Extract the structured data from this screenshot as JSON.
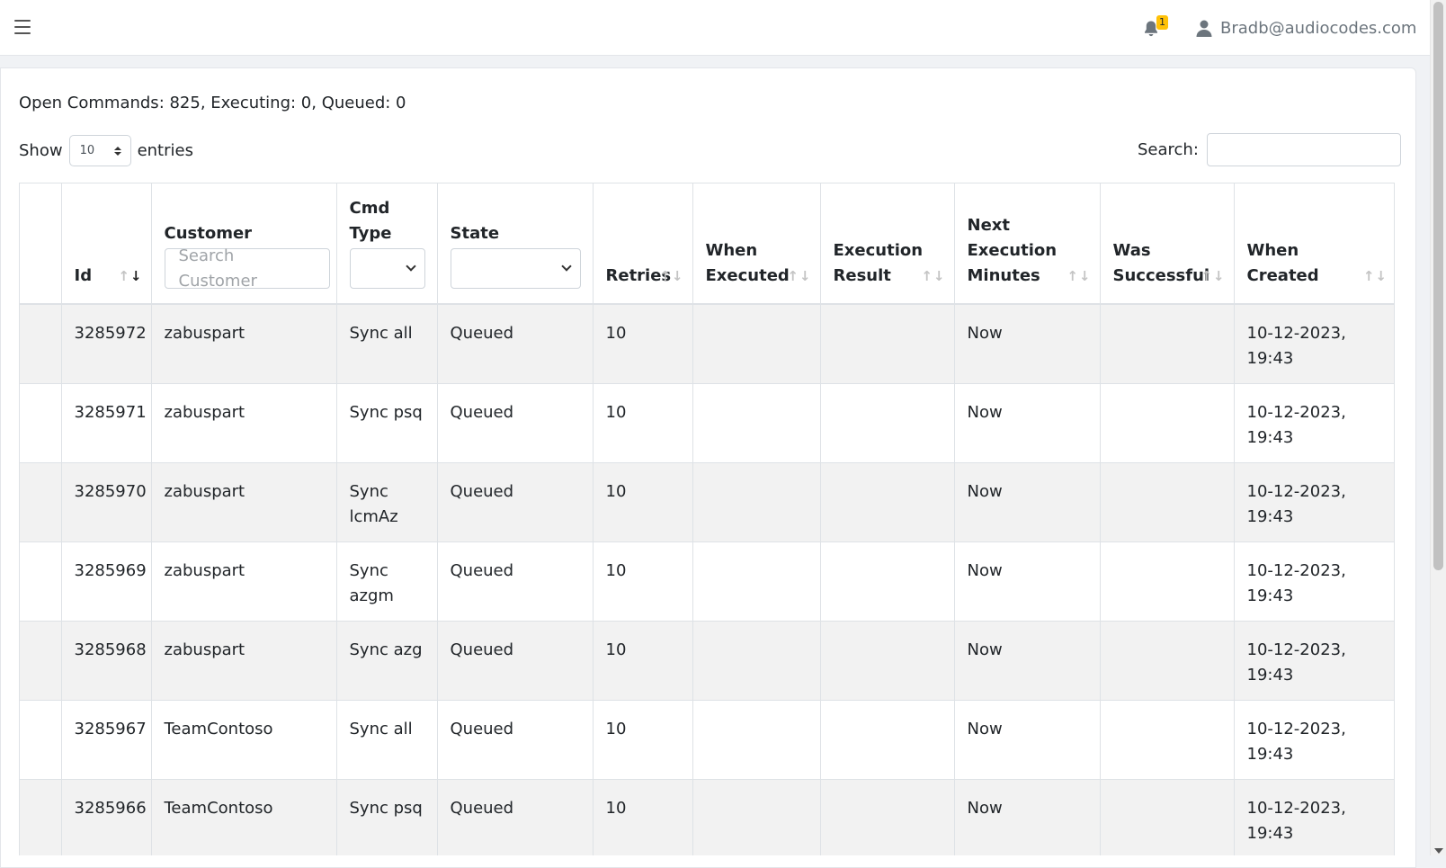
{
  "header": {
    "notification_count": "1",
    "user_email": "Bradb@audiocodes.com"
  },
  "summary": "Open Commands: 825, Executing: 0, Queued: 0",
  "length_control": {
    "show_label": "Show",
    "value": "10",
    "entries_label": "entries"
  },
  "search": {
    "label": "Search:",
    "value": ""
  },
  "table": {
    "columns": {
      "id": "Id",
      "customer": "Customer",
      "customer_placeholder": "Search Customer",
      "cmd_type_1": "Cmd",
      "cmd_type_2": "Type",
      "state": "State",
      "retries": "Retries",
      "when_executed_1": "When",
      "when_executed_2": "Executed",
      "execution_result_1": "Execution",
      "execution_result_2": "Result",
      "next_exec_1": "Next",
      "next_exec_2": "Execution",
      "next_exec_3": "Minutes",
      "was_successful_1": "Was",
      "was_successful_2": "Successful",
      "when_created_1": "When",
      "when_created_2": "Created"
    },
    "rows": [
      {
        "id": "3285972",
        "customer": "zabuspart",
        "cmd_type": "Sync all",
        "state": "Queued",
        "retries": "10",
        "when_executed": "",
        "execution_result": "",
        "next_exec": "Now",
        "was_successful": "",
        "created_date": "10-12-2023,",
        "created_time": "19:43"
      },
      {
        "id": "3285971",
        "customer": "zabuspart",
        "cmd_type": "Sync psq",
        "state": "Queued",
        "retries": "10",
        "when_executed": "",
        "execution_result": "",
        "next_exec": "Now",
        "was_successful": "",
        "created_date": "10-12-2023,",
        "created_time": "19:43"
      },
      {
        "id": "3285970",
        "customer": "zabuspart",
        "cmd_type": "Sync lcmAz",
        "state": "Queued",
        "retries": "10",
        "when_executed": "",
        "execution_result": "",
        "next_exec": "Now",
        "was_successful": "",
        "created_date": "10-12-2023,",
        "created_time": "19:43"
      },
      {
        "id": "3285969",
        "customer": "zabuspart",
        "cmd_type": "Sync azgm",
        "state": "Queued",
        "retries": "10",
        "when_executed": "",
        "execution_result": "",
        "next_exec": "Now",
        "was_successful": "",
        "created_date": "10-12-2023,",
        "created_time": "19:43"
      },
      {
        "id": "3285968",
        "customer": "zabuspart",
        "cmd_type": "Sync azg",
        "state": "Queued",
        "retries": "10",
        "when_executed": "",
        "execution_result": "",
        "next_exec": "Now",
        "was_successful": "",
        "created_date": "10-12-2023,",
        "created_time": "19:43"
      },
      {
        "id": "3285967",
        "customer": "TeamContoso",
        "cmd_type": "Sync all",
        "state": "Queued",
        "retries": "10",
        "when_executed": "",
        "execution_result": "",
        "next_exec": "Now",
        "was_successful": "",
        "created_date": "10-12-2023,",
        "created_time": "19:43"
      },
      {
        "id": "3285966",
        "customer": "TeamContoso",
        "cmd_type": "Sync psq",
        "state": "Queued",
        "retries": "10",
        "when_executed": "",
        "execution_result": "",
        "next_exec": "Now",
        "was_successful": "",
        "created_date": "10-12-2023,",
        "created_time": "19:43"
      }
    ]
  },
  "icons": {
    "menu": "hamburger-menu-icon",
    "bell": "bell-icon",
    "user": "user-icon",
    "sort": "sort-arrows-icon",
    "dropdown": "chevron-down-icon"
  },
  "colors": {
    "badge": "#ffc107",
    "stripe": "#f2f2f2",
    "border": "#dee2e6",
    "muted_text": "#6c757d"
  }
}
